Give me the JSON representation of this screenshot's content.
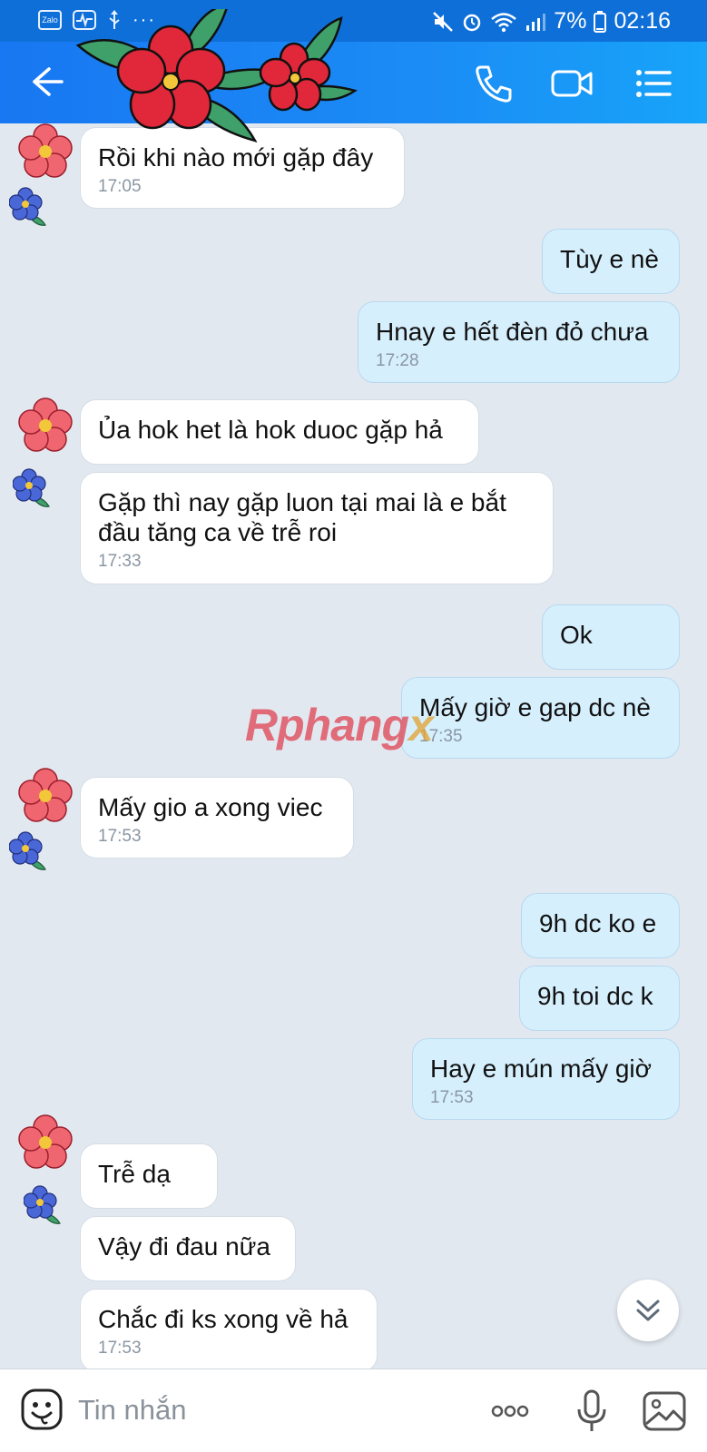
{
  "status_bar": {
    "left_icons": [
      "zalo-icon",
      "activity-icon",
      "usb-icon"
    ],
    "zalo_label": "Zalo",
    "more": "···",
    "right_icons": [
      "mute-icon",
      "alarm-icon",
      "wifi-icon",
      "signal-icon"
    ],
    "battery": "7%",
    "time": "02:16"
  },
  "header": {
    "buttons": [
      "back-icon",
      "call-icon",
      "video-call-icon",
      "menu-icon"
    ]
  },
  "watermark": {
    "main": "Rphang",
    "accent": "x"
  },
  "messages": [
    {
      "dir": "in",
      "text": "Rồi khi nào mới gặp đây",
      "time": "17:05"
    },
    {
      "dir": "out",
      "text": "Tùy e nè",
      "time": ""
    },
    {
      "dir": "out",
      "text": "Hnay e hết đèn đỏ chưa",
      "time": "17:28"
    },
    {
      "dir": "in",
      "text": "Ủa hok het là hok duoc gặp hả",
      "time": ""
    },
    {
      "dir": "in",
      "text": "Gặp thì nay gặp luon tại mai là e bắt đầu tăng ca về trễ roi",
      "time": "17:33"
    },
    {
      "dir": "out",
      "text": "Ok",
      "time": ""
    },
    {
      "dir": "out",
      "text": "Mấy giờ e gap dc nè",
      "time": "17:35"
    },
    {
      "dir": "in",
      "text": "Mấy gio a xong viec",
      "time": "17:53"
    },
    {
      "dir": "out",
      "text": "9h dc ko e",
      "time": ""
    },
    {
      "dir": "out",
      "text": "9h toi dc k",
      "time": ""
    },
    {
      "dir": "out",
      "text": "Hay e mún mấy giờ",
      "time": "17:53"
    },
    {
      "dir": "in",
      "text": "Trễ dạ",
      "time": ""
    },
    {
      "dir": "in",
      "text": "Vậy đi đau nữa",
      "time": ""
    },
    {
      "dir": "in",
      "text": "Chắc đi ks xong về hả",
      "time": "17:53"
    }
  ],
  "input_bar": {
    "placeholder": "Tin nhắn",
    "buttons": [
      "emoji-icon",
      "more-icon",
      "microphone-icon",
      "image-icon"
    ]
  },
  "colors": {
    "header_start": "#1877f2",
    "header_end": "#17a4f9",
    "incoming_bubble": "#ffffff",
    "outgoing_bubble": "#d6effd",
    "background": "#e2e8f0"
  }
}
